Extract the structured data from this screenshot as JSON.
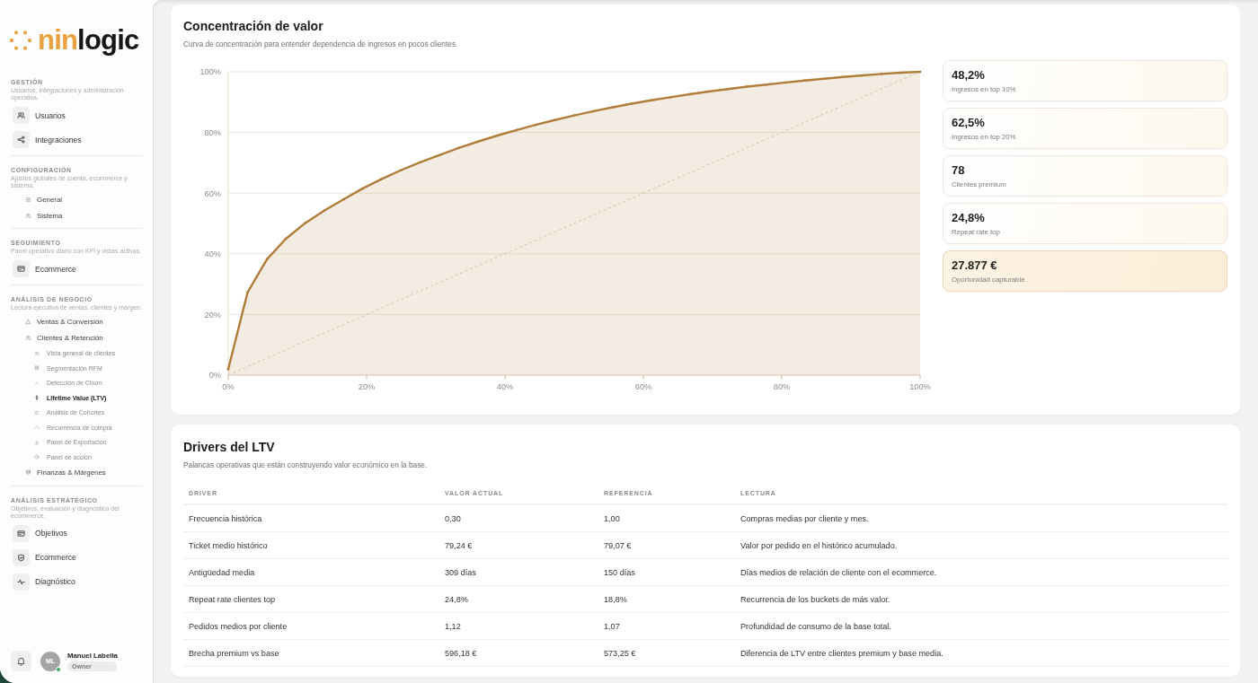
{
  "brand": {
    "name_accent": "nin",
    "name_rest": "logic"
  },
  "sidebar": {
    "sections": [
      {
        "title": "GESTIÓN",
        "description": "Usuarios, integraciones y administración operativa.",
        "items": [
          {
            "label": "Usuarios",
            "kind": "tile",
            "selected": false
          },
          {
            "label": "Integraciones",
            "kind": "tile",
            "selected": false
          }
        ]
      },
      {
        "title": "CONFIGURACIÓN",
        "description": "Ajustes globales de cuenta, ecommerce y sistema.",
        "items": [
          {
            "label": "General",
            "kind": "plain",
            "selected": false
          },
          {
            "label": "Sistema",
            "kind": "plain",
            "selected": false
          }
        ]
      },
      {
        "title": "SEGUIMIENTO",
        "description": "Panel operativo diario con KPI y vistas activas.",
        "items": [
          {
            "label": "Ecommerce",
            "kind": "tile",
            "selected": false
          }
        ]
      },
      {
        "title": "ANÁLISIS DE NEGOCIO",
        "description": "Lectura ejecutiva de ventas, clientes y margen.",
        "items": [
          {
            "label": "Ventas & Conversión",
            "kind": "plain",
            "selected": false
          },
          {
            "label": "Clientes & Retención",
            "kind": "plain",
            "selected": false,
            "children": [
              {
                "label": "Vista general de clientes",
                "selected": false
              },
              {
                "label": "Segmentación RFM",
                "selected": false
              },
              {
                "label": "Detección de Churn",
                "selected": false
              },
              {
                "label": "Lifetime Value (LTV)",
                "selected": true
              },
              {
                "label": "Análisis de Cohortes",
                "selected": false
              },
              {
                "label": "Recurrencia de compra",
                "selected": false
              },
              {
                "label": "Panel de Exportación",
                "selected": false
              },
              {
                "label": "Panel de acción",
                "selected": false
              }
            ]
          },
          {
            "label": "Finanzas & Márgenes",
            "kind": "plain",
            "selected": false
          }
        ]
      },
      {
        "title": "ANÁLISIS ESTRATÉGICO",
        "description": "Objetivos, evaluación y diagnóstico del ecommerce.",
        "items": [
          {
            "label": "Objetivos",
            "kind": "tile",
            "selected": false
          },
          {
            "label": "Ecommerce",
            "kind": "tile",
            "selected": false
          },
          {
            "label": "Diagnóstico",
            "kind": "tile",
            "selected": false
          }
        ]
      }
    ],
    "user": {
      "initials": "ML",
      "name": "Manuel Labella",
      "role": "Owner",
      "online": true
    }
  },
  "concentration": {
    "title": "Concentración de valor",
    "subtitle": "Curva de concentración para entender dependencia de ingresos en pocos clientes.",
    "chart_data": {
      "type": "area",
      "x": [
        0,
        2.8,
        5.6,
        8.3,
        11.1,
        13.9,
        16.7,
        19.4,
        22.2,
        25,
        27.8,
        30.6,
        33.3,
        36.1,
        38.9,
        41.7,
        44.4,
        47.2,
        50,
        52.8,
        55.6,
        58.3,
        61.1,
        63.9,
        66.7,
        69.4,
        72.2,
        75,
        77.8,
        80.6,
        83.3,
        86.1,
        88.9,
        91.7,
        94.4,
        97.2,
        100
      ],
      "series": [
        {
          "color": "#b07d3a",
          "values": [
            2,
            27.3,
            38.2,
            44.9,
            50.1,
            54.3,
            58,
            61.5,
            64.7,
            67.6,
            70.2,
            72.6,
            74.9,
            77,
            79,
            80.8,
            82.5,
            84.1,
            85.6,
            87,
            88.3,
            89.5,
            90.6,
            91.6,
            92.6,
            93.5,
            94.3,
            95.1,
            95.8,
            96.5,
            97.1,
            97.7,
            98.3,
            98.8,
            99.3,
            99.7,
            100
          ]
        }
      ],
      "xlim": [
        0,
        100
      ],
      "ylim": [
        0,
        100
      ],
      "xticks": [
        {
          "value": 0,
          "label": "0%"
        },
        {
          "value": 20,
          "label": "20%"
        },
        {
          "value": 40,
          "label": "40%"
        },
        {
          "value": 60,
          "label": "60%"
        },
        {
          "value": 80,
          "label": "80%"
        },
        {
          "value": 100,
          "label": "100%"
        }
      ],
      "yticks": [
        {
          "value": 0,
          "label": "0%"
        },
        {
          "value": 20,
          "label": "20%"
        },
        {
          "value": 40,
          "label": "40%"
        },
        {
          "value": 60,
          "label": "60%"
        },
        {
          "value": 80,
          "label": "80%"
        },
        {
          "value": 100,
          "label": "100%"
        }
      ],
      "grid": true
    },
    "equality_diagonal": {
      "shown": true,
      "color": "#d8c3a3"
    },
    "kpis": [
      {
        "value": "48,2%",
        "label": "Ingresos en top 10%",
        "highlighted": false
      },
      {
        "value": "62,5%",
        "label": "Ingresos en top 20%",
        "highlighted": false
      },
      {
        "value": "78",
        "label": "Clientes premium",
        "highlighted": false
      },
      {
        "value": "24,8%",
        "label": "Repeat rate top",
        "highlighted": false
      },
      {
        "value": "27.877 €",
        "label": "Oportunidad capturable",
        "highlighted": true
      }
    ]
  },
  "drivers": {
    "title": "Drivers del LTV",
    "subtitle": "Palancas operativas que están construyendo valor económico en la base.",
    "table": {
      "columns": [
        "DRIVER",
        "VALOR ACTUAL",
        "REFERENCIA",
        "LECTURA"
      ],
      "rows": [
        [
          "Frecuencia histórica",
          "0,30",
          "1,00",
          "Compras medias por cliente y mes."
        ],
        [
          "Ticket medio histórico",
          "79,24 €",
          "79,07 €",
          "Valor por pedido en el histórico acumulado."
        ],
        [
          "Antigüedad media",
          "309 días",
          "150 días",
          "Días medios de relación de cliente con el ecommerce."
        ],
        [
          "Repeat rate clientes top",
          "24,8%",
          "18,8%",
          "Recurrencia de los buckets de más valor."
        ],
        [
          "Pedidos medios por cliente",
          "1,12",
          "1,07",
          "Profundidad de consumo de la base total."
        ],
        [
          "Brecha premium vs base",
          "596,18 €",
          "573,25 €",
          "Diferencia de LTV entre clientes premium y base media."
        ]
      ]
    }
  }
}
